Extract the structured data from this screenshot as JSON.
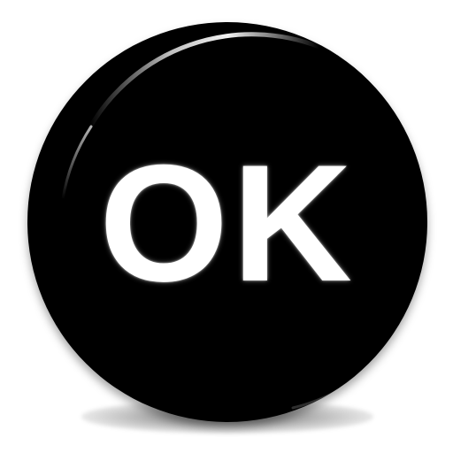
{
  "button": {
    "label": "OK",
    "face_color": "#000000",
    "text_color": "#ffffff",
    "highlight_color": "#ffffff"
  }
}
